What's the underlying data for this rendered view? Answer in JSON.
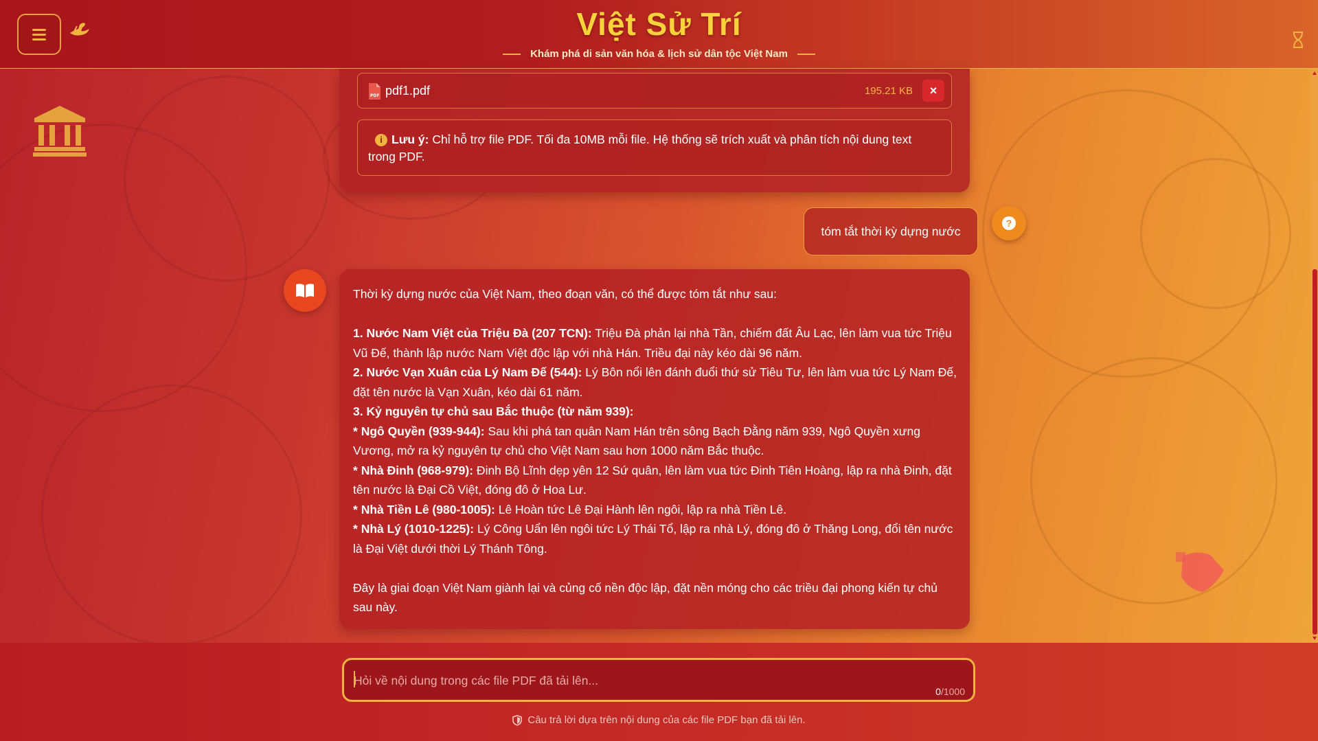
{
  "header": {
    "title": "Việt Sử Trí",
    "subtitle": "Khám phá di sản văn hóa & lịch sử dân tộc Việt Nam",
    "menu_icon": "hamburger-icon",
    "logo_icon": "dragon-boat-icon",
    "right_icon": "hourglass-icon"
  },
  "decorations": {
    "left_icon": "museum-icon",
    "right_icon": "scroll-icon"
  },
  "upload": {
    "file_name": "pdf1.pdf",
    "file_size": "195.21 KB",
    "remove_label": "×",
    "note_label": "Lưu ý:",
    "note_text": "Chỉ hỗ trợ file PDF. Tối đa 10MB mỗi file. Hệ thống sẽ trích xuất và phân tích nội dung text trong PDF."
  },
  "conversation": {
    "user_message": "tóm tắt thời kỳ dựng nước",
    "user_avatar_glyph": "?",
    "assistant": {
      "intro": "Thời kỳ dựng nước của Việt Nam, theo đoạn văn, có thể được tóm tắt như sau:",
      "items": [
        {
          "prefix": "1. ",
          "title": "Nước Nam Việt của Triệu Đà (207 TCN):",
          "text": " Triệu Đà phản lại nhà Tần, chiếm đất Âu Lạc, lên làm vua tức Triệu Vũ Đế, thành lập nước Nam Việt độc lập với nhà Hán. Triều đại này kéo dài 96 năm."
        },
        {
          "prefix": "2. ",
          "title": "Nước Vạn Xuân của Lý Nam Đế (544):",
          "text": " Lý Bôn nổi lên đánh đuổi thứ sử Tiêu Tư, lên làm vua tức Lý Nam Đế, đặt tên nước là Vạn Xuân, kéo dài 61 năm."
        },
        {
          "prefix": "3. ",
          "title": "Kỷ nguyên tự chủ sau Bắc thuộc (từ năm 939):",
          "text": ""
        },
        {
          "prefix": "* ",
          "title": "Ngô Quyền (939-944):",
          "text": " Sau khi phá tan quân Nam Hán trên sông Bạch Đằng năm 939, Ngô Quyền xưng Vương, mở ra kỷ nguyên tự chủ cho Việt Nam sau hơn 1000 năm Bắc thuộc."
        },
        {
          "prefix": "* ",
          "title": "Nhà Đinh (968-979):",
          "text": " Đinh Bộ Lĩnh dẹp yên 12 Sứ quân, lên làm vua tức Đinh Tiên Hoàng, lập ra nhà Đinh, đặt tên nước là Đại Cồ Việt, đóng đô ở Hoa Lư."
        },
        {
          "prefix": "* ",
          "title": "Nhà Tiền Lê (980-1005):",
          "text": " Lê Hoàn tức Lê Đại Hành lên ngôi, lập ra nhà Tiền Lê."
        },
        {
          "prefix": "* ",
          "title": "Nhà Lý (1010-1225):",
          "text": " Lý Công Uẩn lên ngôi tức Lý Thái Tổ, lập ra nhà Lý, đóng đô ở Thăng Long, đổi tên nước là Đại Việt dưới thời Lý Thánh Tông."
        }
      ],
      "conclusion": "Đây là giai đoạn Việt Nam giành lại và củng cố nền độc lập, đặt nền móng cho các triều đại phong kiến tự chủ sau này."
    }
  },
  "input": {
    "placeholder": "Hỏi về nội dung trong các file PDF đã tải lên...",
    "value": "",
    "count_current": "0",
    "count_max": "/1000"
  },
  "footer": {
    "disclaimer": "Câu trả lời dựa trên nội dung của các file PDF bạn đã tải lên."
  },
  "colors": {
    "accent_gold": "#f1b43f",
    "title_yellow": "#f7d23a",
    "primary_red": "#b71d22",
    "remove_red": "#d8282b"
  }
}
